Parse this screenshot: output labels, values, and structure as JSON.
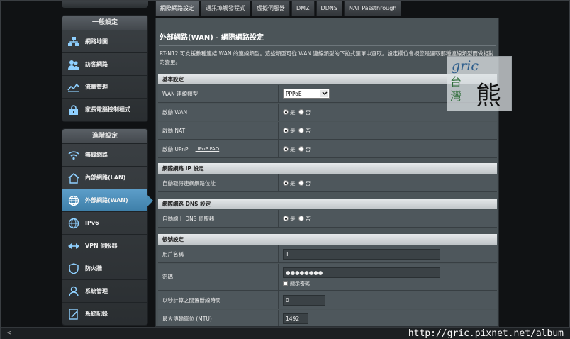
{
  "tabs": [
    "網際網路設定",
    "通訊埠觸發程式",
    "虛擬伺服器",
    "DMZ",
    "DDNS",
    "NAT Passthrough"
  ],
  "sidebar": {
    "general_title": "一般設定",
    "general_items": [
      {
        "label": "網路地圖",
        "icon": "network-map-icon"
      },
      {
        "label": "訪客網路",
        "icon": "guest-network-icon"
      },
      {
        "label": "流量管理",
        "icon": "traffic-manager-icon"
      },
      {
        "label": "家長電腦控制程式",
        "icon": "parental-control-icon"
      }
    ],
    "advanced_title": "進階設定",
    "advanced_items": [
      {
        "label": "無線網路",
        "icon": "wireless-icon"
      },
      {
        "label": "內部網路(LAN)",
        "icon": "lan-home-icon"
      },
      {
        "label": "外部網路(WAN)",
        "icon": "wan-globe-icon"
      },
      {
        "label": "IPv6",
        "icon": "ipv6-icon"
      },
      {
        "label": "VPN 伺服器",
        "icon": "vpn-icon"
      },
      {
        "label": "防火牆",
        "icon": "firewall-shield-icon"
      },
      {
        "label": "系統管理",
        "icon": "administration-icon"
      },
      {
        "label": "系統記錄",
        "icon": "system-log-icon"
      }
    ]
  },
  "main": {
    "title": "外部網路(WAN) - 網際網路設定",
    "description": "RT-N12 可支援數種連結 WAN 的連線類型。這些類型可從 WAN 連線類型的下拉式選單中選取。設定欄位會視您是選取那種連線類型而做相對的變更。",
    "sections": {
      "basic": "基本設定",
      "ip": "網際網路 IP 設定",
      "dns": "網際網路 DNS 設定",
      "account": "帳號設定"
    },
    "rows": {
      "wan_type_label": "WAN 連線類型",
      "wan_type_value": "PPPoE",
      "enable_wan_label": "啟動 WAN",
      "enable_nat_label": "啟動 NAT",
      "enable_upnp_label": "啟動 UPnP",
      "upnp_faq": "UPnP  FAQ",
      "auto_ip_label": "自動取得連網網路位址",
      "auto_dns_label": "自動線上 DNS 伺服器",
      "username_label": "用戶名稱",
      "username_value": "T",
      "password_label": "密碼",
      "password_value": "●●●●●●●●",
      "show_password": "顯示密碼",
      "idle_label": "以秒計算之閒置斷線時間",
      "idle_value": "0",
      "mtu_label": "最大傳輸單位 (MTU)",
      "mtu_value": "1492"
    },
    "yes": "是",
    "no": "否"
  },
  "watermark": {
    "brand": "gric",
    "tw": "台灣",
    "bear": "熊"
  },
  "footer_url": "http://gric.pixnet.net/album",
  "scroll_left": "<"
}
